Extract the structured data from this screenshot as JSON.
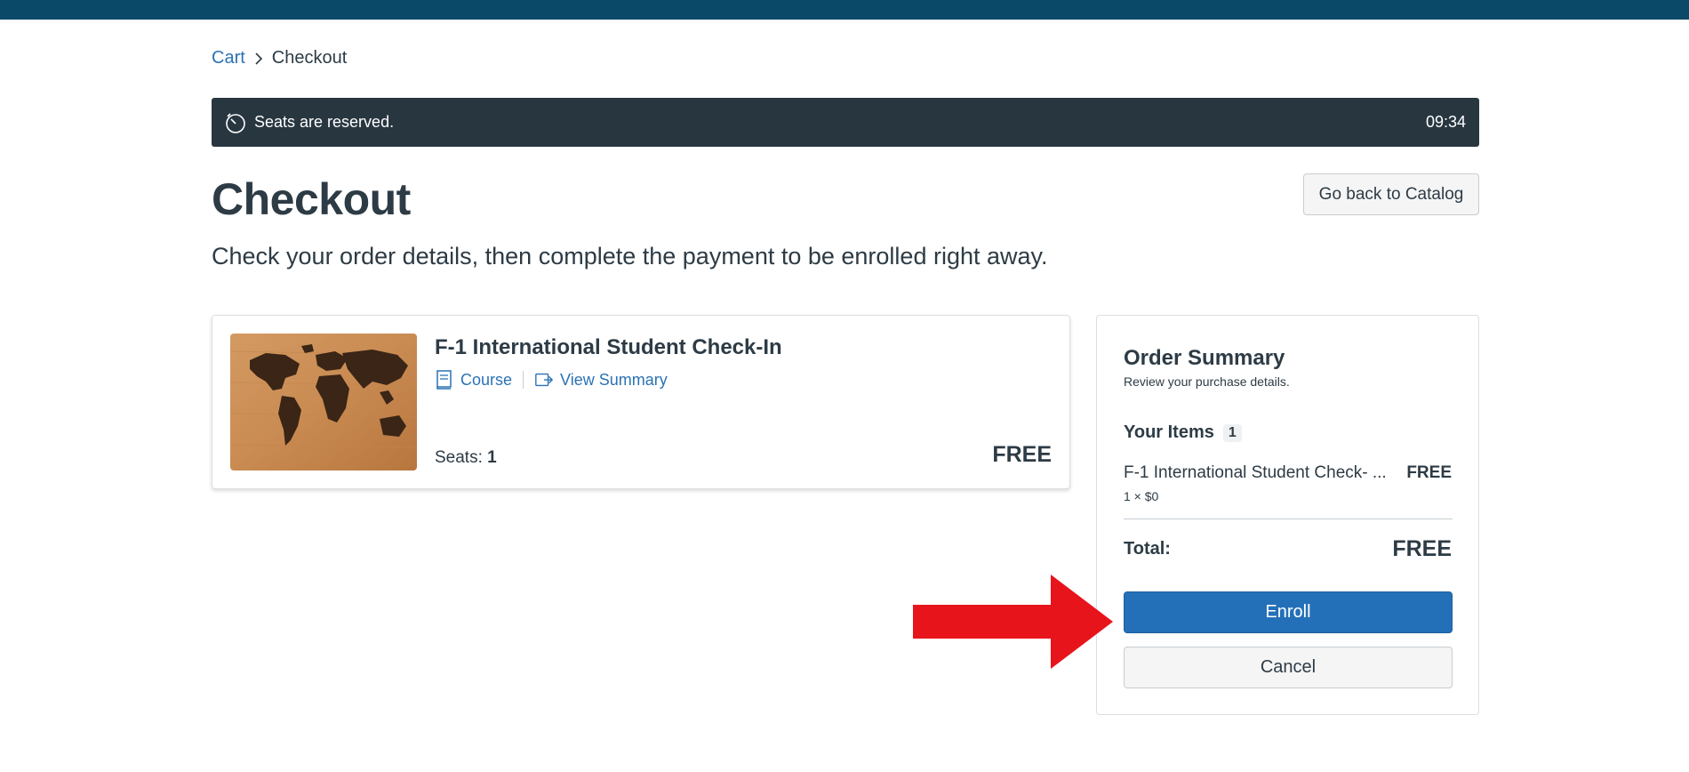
{
  "breadcrumb": {
    "cart": "Cart",
    "current": "Checkout"
  },
  "reservation": {
    "message": "Seats are reserved.",
    "time": "09:34"
  },
  "page": {
    "title": "Checkout",
    "subtitle": "Check your order details, then complete the payment to be enrolled right away.",
    "back_button": "Go back to Catalog"
  },
  "item": {
    "title": "F-1 International Student Check-In",
    "type": "Course",
    "view_summary": "View Summary",
    "seats_label": "Seats:",
    "seats_value": "1",
    "price": "FREE"
  },
  "summary": {
    "title": "Order Summary",
    "subtitle": "Review your purchase details.",
    "items_label": "Your Items",
    "items_count": "1",
    "line_name": "F-1 International Student Check- ...",
    "line_price": "FREE",
    "line_qty": "1 × $0",
    "total_label": "Total:",
    "total_value": "FREE",
    "enroll_button": "Enroll",
    "cancel_button": "Cancel"
  },
  "colors": {
    "topbar": "#0a4a68",
    "timer_bar": "#283640",
    "primary": "#2470b8",
    "link": "#2b72b5",
    "annotation_arrow": "#e8141b"
  }
}
